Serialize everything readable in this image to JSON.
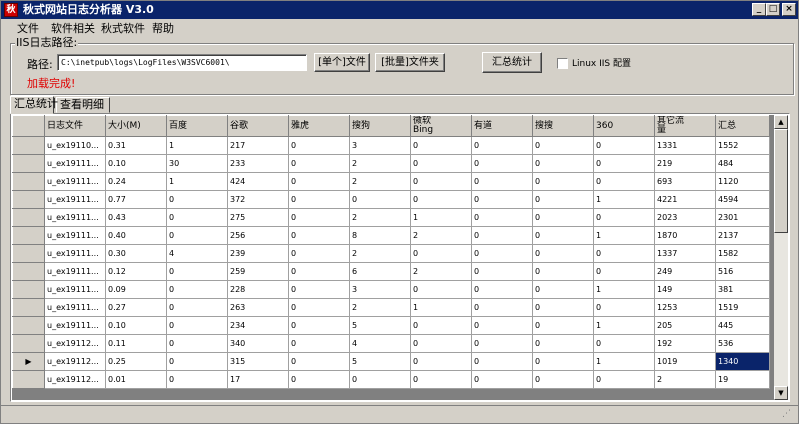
{
  "window": {
    "title": "秋式网站日志分析器 V3.0",
    "app_icon": "秋",
    "controls": {
      "minimize": "_",
      "maximize": "□",
      "close": "×"
    }
  },
  "menu": [
    "文件",
    "软件相关",
    "秋式软件",
    "帮助"
  ],
  "settings": {
    "group_label": "IIS日志路径:",
    "path_label": "路径:",
    "path_value": "C:\\inetpub\\logs\\LogFiles\\W3SVC6001\\",
    "single_file_button": "[单个]文件",
    "batch_folder_button": "[批量]文件夹",
    "summary_button": "汇总统计",
    "linux_checkbox_label": "Linux IIS 配置",
    "linux_checked": false,
    "status": "加载完成!"
  },
  "tabs": [
    "汇总统计",
    "查看明细"
  ],
  "active_tab": 0,
  "grid": {
    "columns": [
      "日志文件",
      "大小(M)",
      "百度",
      "谷歌",
      "雅虎",
      "搜狗",
      "微软\nBing",
      "有道",
      "搜搜",
      "360",
      "其它流\n量",
      "汇总"
    ],
    "rows": [
      [
        "u_ex19110...",
        "0.31",
        "1",
        "217",
        "0",
        "3",
        "0",
        "0",
        "0",
        "0",
        "1331",
        "1552"
      ],
      [
        "u_ex19111...",
        "0.10",
        "30",
        "233",
        "0",
        "2",
        "0",
        "0",
        "0",
        "0",
        "219",
        "484"
      ],
      [
        "u_ex19111...",
        "0.24",
        "1",
        "424",
        "0",
        "2",
        "0",
        "0",
        "0",
        "0",
        "693",
        "1120"
      ],
      [
        "u_ex19111...",
        "0.77",
        "0",
        "372",
        "0",
        "0",
        "0",
        "0",
        "0",
        "1",
        "4221",
        "4594"
      ],
      [
        "u_ex19111...",
        "0.43",
        "0",
        "275",
        "0",
        "2",
        "1",
        "0",
        "0",
        "0",
        "2023",
        "2301"
      ],
      [
        "u_ex19111...",
        "0.40",
        "0",
        "256",
        "0",
        "8",
        "2",
        "0",
        "0",
        "1",
        "1870",
        "2137"
      ],
      [
        "u_ex19111...",
        "0.30",
        "4",
        "239",
        "0",
        "2",
        "0",
        "0",
        "0",
        "0",
        "1337",
        "1582"
      ],
      [
        "u_ex19111...",
        "0.12",
        "0",
        "259",
        "0",
        "6",
        "2",
        "0",
        "0",
        "0",
        "249",
        "516"
      ],
      [
        "u_ex19111...",
        "0.09",
        "0",
        "228",
        "0",
        "3",
        "0",
        "0",
        "0",
        "1",
        "149",
        "381"
      ],
      [
        "u_ex19111...",
        "0.27",
        "0",
        "263",
        "0",
        "2",
        "1",
        "0",
        "0",
        "0",
        "1253",
        "1519"
      ],
      [
        "u_ex19111...",
        "0.10",
        "0",
        "234",
        "0",
        "5",
        "0",
        "0",
        "0",
        "1",
        "205",
        "445"
      ],
      [
        "u_ex19112...",
        "0.11",
        "0",
        "340",
        "0",
        "4",
        "0",
        "0",
        "0",
        "0",
        "192",
        "536"
      ],
      [
        "u_ex19112...",
        "0.25",
        "0",
        "315",
        "0",
        "5",
        "0",
        "0",
        "0",
        "1",
        "1019",
        "1340"
      ],
      [
        "u_ex19112...",
        "0.01",
        "0",
        "17",
        "0",
        "0",
        "0",
        "0",
        "0",
        "0",
        "2",
        "19"
      ]
    ],
    "current_row": 12,
    "current_marker": "▶",
    "selected_cell": {
      "row": 12,
      "col": 11
    }
  },
  "scrollbar": {
    "up": "▲",
    "down": "▼"
  },
  "statusbar": {
    "grip": "⋰"
  }
}
